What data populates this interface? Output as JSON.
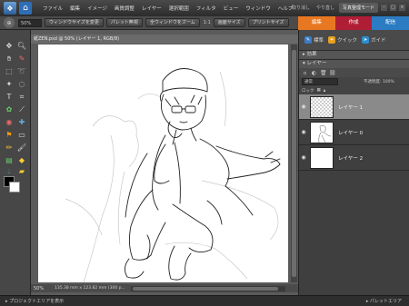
{
  "menubar": {
    "home_icon": "home-icon",
    "items": [
      "ファイル",
      "編集",
      "イメージ",
      "画質調整",
      "レイヤー",
      "選択範囲",
      "フィルタ",
      "ビュー",
      "ウィンドウ",
      "ヘルプ"
    ],
    "undo_label": "取り消し",
    "redo_label": "やり直し",
    "organizer_label": "写真整理モード"
  },
  "options": {
    "zoom_value": "50%",
    "buttons": [
      "ウィンドウサイズを変更",
      "パレット無視",
      "全ウィンドウをズーム",
      "1:1",
      "画面サイズ",
      "プリントサイズ"
    ]
  },
  "modetabs": [
    "編集",
    "作成",
    "配信"
  ],
  "document": {
    "title": "紙ZEN.psd @ 50% (レイヤー 1, RGB/8)",
    "status_zoom": "50%",
    "status_info": "135.38 mm x 123.82 mm (300 p..."
  },
  "panel": {
    "actions": [
      {
        "label": "標準",
        "icon": "pencil-icon",
        "color": "#3a7dc9"
      },
      {
        "label": "クイック",
        "icon": "wand-icon",
        "color": "#e8a020"
      },
      {
        "label": "ガイド",
        "icon": "guide-icon",
        "color": "#2b8fd0"
      }
    ],
    "effects_label": "効果",
    "layers_label": "レイヤー",
    "blend_mode": "通常",
    "opacity_label": "不透明度: 100%",
    "lock_label": "ロック",
    "layers": [
      {
        "name": "レイヤー 1",
        "active": true,
        "thumb": "checker"
      },
      {
        "name": "レイヤー 0",
        "active": false,
        "thumb": "sketch"
      },
      {
        "name": "レイヤー 2",
        "active": false,
        "thumb": "white"
      }
    ]
  },
  "bottom": {
    "project_bin": "プロジェクトエリアを表示",
    "panel_bin": "パレットエリア"
  }
}
